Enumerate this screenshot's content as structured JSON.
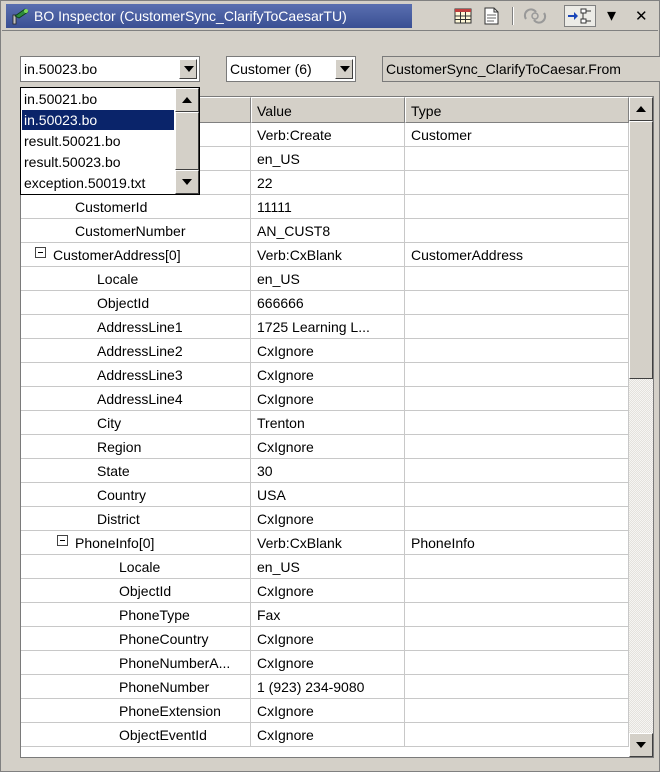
{
  "window": {
    "title": "BO Inspector (CustomerSync_ClarifyToCaesarTU)",
    "close_glyph": "✕",
    "menu_glyph": "▾",
    "accent_color": "#3a4f93"
  },
  "toolbar": {
    "icons": [
      "table-view-icon",
      "document-view-icon",
      "refresh-link-icon",
      "flow-arrow-icon",
      "view-menu-icon",
      "close-icon"
    ]
  },
  "file_combo": {
    "value": "in.50023.bo",
    "options": [
      "in.50021.bo",
      "in.50023.bo",
      "result.50021.bo",
      "result.50023.bo",
      "exception.50019.txt"
    ],
    "selected_index": 1
  },
  "type_combo": {
    "value": "Customer (6)"
  },
  "path_field": {
    "value": "CustomerSync_ClarifyToCaesar.From"
  },
  "table": {
    "headers": {
      "value": "Value",
      "type": "Type"
    },
    "rows": [
      {
        "name": "",
        "value": "Verb:Create",
        "type": "Customer"
      },
      {
        "name": "",
        "value": "en_US",
        "type": ""
      },
      {
        "name": "",
        "value": "22",
        "type": ""
      },
      {
        "name": "CustomerId",
        "value": "11111",
        "type": ""
      },
      {
        "name": "CustomerNumber",
        "value": "AN_CUST8",
        "type": ""
      },
      {
        "name": "CustomerAddress[0]",
        "value": "Verb:CxBlank",
        "type": "CustomerAddress",
        "expander": true
      },
      {
        "name": "Locale",
        "value": "en_US",
        "type": ""
      },
      {
        "name": "ObjectId",
        "value": "666666",
        "type": ""
      },
      {
        "name": "AddressLine1",
        "value": "1725 Learning L...",
        "type": ""
      },
      {
        "name": "AddressLine2",
        "value": "CxIgnore",
        "type": ""
      },
      {
        "name": "AddressLine3",
        "value": "CxIgnore",
        "type": ""
      },
      {
        "name": "AddressLine4",
        "value": "CxIgnore",
        "type": ""
      },
      {
        "name": "City",
        "value": "Trenton",
        "type": ""
      },
      {
        "name": "Region",
        "value": "CxIgnore",
        "type": ""
      },
      {
        "name": "State",
        "value": "30",
        "type": ""
      },
      {
        "name": "Country",
        "value": "USA",
        "type": ""
      },
      {
        "name": "District",
        "value": "CxIgnore",
        "type": ""
      },
      {
        "name": "PhoneInfo[0]",
        "value": "Verb:CxBlank",
        "type": "PhoneInfo",
        "expander": true
      },
      {
        "name": "Locale",
        "value": "en_US",
        "type": ""
      },
      {
        "name": "ObjectId",
        "value": "CxIgnore",
        "type": ""
      },
      {
        "name": "PhoneType",
        "value": "Fax",
        "type": ""
      },
      {
        "name": "PhoneCountry",
        "value": "CxIgnore",
        "type": ""
      },
      {
        "name": "PhoneNumberA...",
        "value": "CxIgnore",
        "type": ""
      },
      {
        "name": "PhoneNumber",
        "value": "1 (923) 234-9080",
        "type": ""
      },
      {
        "name": "PhoneExtension",
        "value": "CxIgnore",
        "type": ""
      },
      {
        "name": "ObjectEventId",
        "value": "CxIgnore",
        "type": ""
      }
    ]
  }
}
